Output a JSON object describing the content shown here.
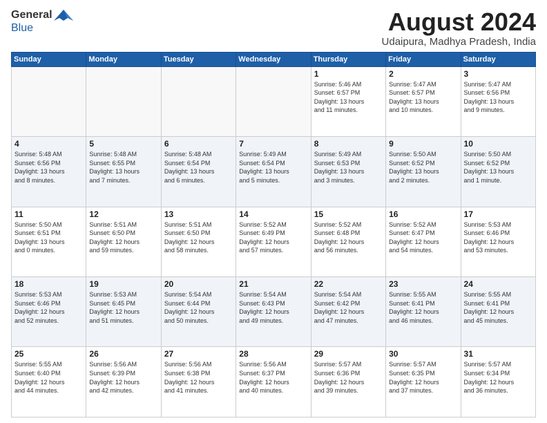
{
  "header": {
    "logo_general": "General",
    "logo_blue": "Blue",
    "month_title": "August 2024",
    "location": "Udaipura, Madhya Pradesh, India"
  },
  "weekdays": [
    "Sunday",
    "Monday",
    "Tuesday",
    "Wednesday",
    "Thursday",
    "Friday",
    "Saturday"
  ],
  "weeks": [
    [
      {
        "day": "",
        "info": ""
      },
      {
        "day": "",
        "info": ""
      },
      {
        "day": "",
        "info": ""
      },
      {
        "day": "",
        "info": ""
      },
      {
        "day": "1",
        "info": "Sunrise: 5:46 AM\nSunset: 6:57 PM\nDaylight: 13 hours\nand 11 minutes."
      },
      {
        "day": "2",
        "info": "Sunrise: 5:47 AM\nSunset: 6:57 PM\nDaylight: 13 hours\nand 10 minutes."
      },
      {
        "day": "3",
        "info": "Sunrise: 5:47 AM\nSunset: 6:56 PM\nDaylight: 13 hours\nand 9 minutes."
      }
    ],
    [
      {
        "day": "4",
        "info": "Sunrise: 5:48 AM\nSunset: 6:56 PM\nDaylight: 13 hours\nand 8 minutes."
      },
      {
        "day": "5",
        "info": "Sunrise: 5:48 AM\nSunset: 6:55 PM\nDaylight: 13 hours\nand 7 minutes."
      },
      {
        "day": "6",
        "info": "Sunrise: 5:48 AM\nSunset: 6:54 PM\nDaylight: 13 hours\nand 6 minutes."
      },
      {
        "day": "7",
        "info": "Sunrise: 5:49 AM\nSunset: 6:54 PM\nDaylight: 13 hours\nand 5 minutes."
      },
      {
        "day": "8",
        "info": "Sunrise: 5:49 AM\nSunset: 6:53 PM\nDaylight: 13 hours\nand 3 minutes."
      },
      {
        "day": "9",
        "info": "Sunrise: 5:50 AM\nSunset: 6:52 PM\nDaylight: 13 hours\nand 2 minutes."
      },
      {
        "day": "10",
        "info": "Sunrise: 5:50 AM\nSunset: 6:52 PM\nDaylight: 13 hours\nand 1 minute."
      }
    ],
    [
      {
        "day": "11",
        "info": "Sunrise: 5:50 AM\nSunset: 6:51 PM\nDaylight: 13 hours\nand 0 minutes."
      },
      {
        "day": "12",
        "info": "Sunrise: 5:51 AM\nSunset: 6:50 PM\nDaylight: 12 hours\nand 59 minutes."
      },
      {
        "day": "13",
        "info": "Sunrise: 5:51 AM\nSunset: 6:50 PM\nDaylight: 12 hours\nand 58 minutes."
      },
      {
        "day": "14",
        "info": "Sunrise: 5:52 AM\nSunset: 6:49 PM\nDaylight: 12 hours\nand 57 minutes."
      },
      {
        "day": "15",
        "info": "Sunrise: 5:52 AM\nSunset: 6:48 PM\nDaylight: 12 hours\nand 56 minutes."
      },
      {
        "day": "16",
        "info": "Sunrise: 5:52 AM\nSunset: 6:47 PM\nDaylight: 12 hours\nand 54 minutes."
      },
      {
        "day": "17",
        "info": "Sunrise: 5:53 AM\nSunset: 6:46 PM\nDaylight: 12 hours\nand 53 minutes."
      }
    ],
    [
      {
        "day": "18",
        "info": "Sunrise: 5:53 AM\nSunset: 6:46 PM\nDaylight: 12 hours\nand 52 minutes."
      },
      {
        "day": "19",
        "info": "Sunrise: 5:53 AM\nSunset: 6:45 PM\nDaylight: 12 hours\nand 51 minutes."
      },
      {
        "day": "20",
        "info": "Sunrise: 5:54 AM\nSunset: 6:44 PM\nDaylight: 12 hours\nand 50 minutes."
      },
      {
        "day": "21",
        "info": "Sunrise: 5:54 AM\nSunset: 6:43 PM\nDaylight: 12 hours\nand 49 minutes."
      },
      {
        "day": "22",
        "info": "Sunrise: 5:54 AM\nSunset: 6:42 PM\nDaylight: 12 hours\nand 47 minutes."
      },
      {
        "day": "23",
        "info": "Sunrise: 5:55 AM\nSunset: 6:41 PM\nDaylight: 12 hours\nand 46 minutes."
      },
      {
        "day": "24",
        "info": "Sunrise: 5:55 AM\nSunset: 6:41 PM\nDaylight: 12 hours\nand 45 minutes."
      }
    ],
    [
      {
        "day": "25",
        "info": "Sunrise: 5:55 AM\nSunset: 6:40 PM\nDaylight: 12 hours\nand 44 minutes."
      },
      {
        "day": "26",
        "info": "Sunrise: 5:56 AM\nSunset: 6:39 PM\nDaylight: 12 hours\nand 42 minutes."
      },
      {
        "day": "27",
        "info": "Sunrise: 5:56 AM\nSunset: 6:38 PM\nDaylight: 12 hours\nand 41 minutes."
      },
      {
        "day": "28",
        "info": "Sunrise: 5:56 AM\nSunset: 6:37 PM\nDaylight: 12 hours\nand 40 minutes."
      },
      {
        "day": "29",
        "info": "Sunrise: 5:57 AM\nSunset: 6:36 PM\nDaylight: 12 hours\nand 39 minutes."
      },
      {
        "day": "30",
        "info": "Sunrise: 5:57 AM\nSunset: 6:35 PM\nDaylight: 12 hours\nand 37 minutes."
      },
      {
        "day": "31",
        "info": "Sunrise: 5:57 AM\nSunset: 6:34 PM\nDaylight: 12 hours\nand 36 minutes."
      }
    ]
  ]
}
